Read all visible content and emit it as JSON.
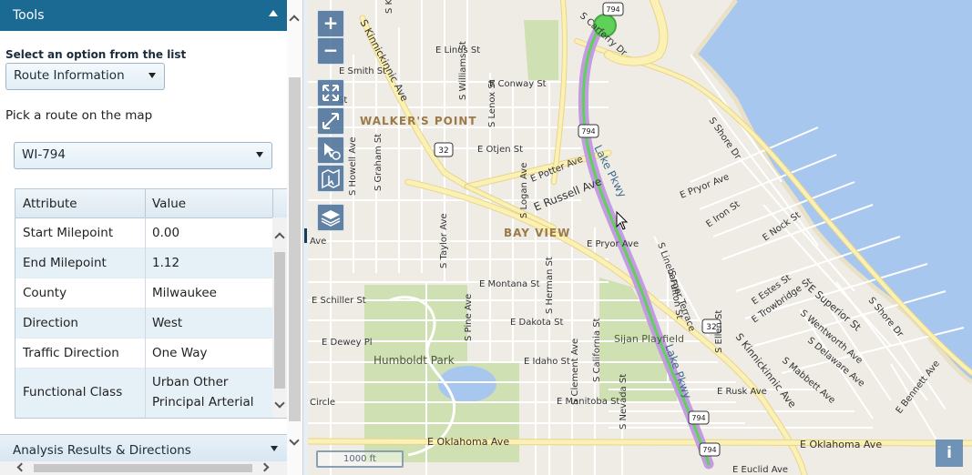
{
  "panel": {
    "title": "Tools",
    "select_label": "Select an option from the list",
    "option_value": "Route Information",
    "pick_text": "Pick a route on the map",
    "route_value": "WI-794",
    "table": {
      "headers": [
        "Attribute",
        "Value"
      ],
      "rows": [
        {
          "attr": "Start Milepoint",
          "value": "0.00"
        },
        {
          "attr": "End Milepoint",
          "value": "1.12"
        },
        {
          "attr": "County",
          "value": "Milwaukee"
        },
        {
          "attr": "Direction",
          "value": "West"
        },
        {
          "attr": "Traffic Direction",
          "value": "One Way"
        },
        {
          "attr": "Functional Class",
          "value": "Urban Other",
          "value2": "Principal Arterial"
        }
      ]
    },
    "footer_title": "Analysis Results & Directions"
  },
  "map": {
    "zoom_in": "+",
    "zoom_out": "−",
    "scale_label": "1000 ft",
    "info_label": "i",
    "labels": {
      "kinnickinnic_n": "S Kinnickinnic Ave",
      "kinnickinnic_s": "S Kinnickinnic Ave",
      "linus": "E Linus St",
      "smith": "E Smith St",
      "conway": "E Conway St",
      "otjen": "E Otjen St",
      "potter": "E Potter Ave",
      "russell": "E Russell Ave",
      "pryor": "E Pryor Ave",
      "pryor_e": "E Pryor Ave",
      "montana": "E Montana St",
      "schiller": "E Schiller St",
      "dakota": "E Dakota St",
      "dewey": "E Dewey Pl",
      "idaho": "E Idaho St",
      "manitoba": "E Manitoba St",
      "oklahoma_w": "E Oklahoma Ave",
      "oklahoma_e": "E Oklahoma Ave",
      "rusk": "E Rusk Ave",
      "euclid": "E Euclid Ave",
      "walkers_point": "WALKER'S POINT",
      "bay_view": "BAY VIEW",
      "humboldt": "Humboldt Park",
      "sijan": "Sijan Playfield",
      "lake_pkwy_n": "Lake Pkwy",
      "lake_pkwy_s": "Lake Pkwy",
      "carferry": "S Carferry Dr",
      "shore": "S Shore Dr",
      "shore_s": "S Shore Dr",
      "superior": "E Superior St",
      "nock": "E Nock St",
      "iron": "E Iron St",
      "pryor_ne": "E Pryor Ave",
      "williams": "S Williams St",
      "lenox": "S Lenox St",
      "graham": "S Graham St",
      "howell": "S Howell Ave",
      "taylor": "S Taylor Ave",
      "logan": "S Logan Ave",
      "herman": "S Herman St",
      "pine": "S Pine Ave",
      "clement": "S Clement Ave",
      "california": "S California St",
      "nevada": "S Nevada St",
      "fulton": "S Fulton St",
      "ellen": "S Ellen St",
      "linebarger": "S Linebarger Terrace",
      "trowbridge": "E Trowbridge St",
      "wentworth": "S Wentworth Ave",
      "delaware": "S Delaware Ave",
      "mabbett": "S Mabbett Ave",
      "bennett": "E Bennett Ave",
      "estes": "E Estes St",
      "kx": "S Kx",
      "circle": "Circle",
      "ave": "Ave",
      "st_left": "St",
      "shield_32": "32",
      "shield_794": "794"
    }
  }
}
